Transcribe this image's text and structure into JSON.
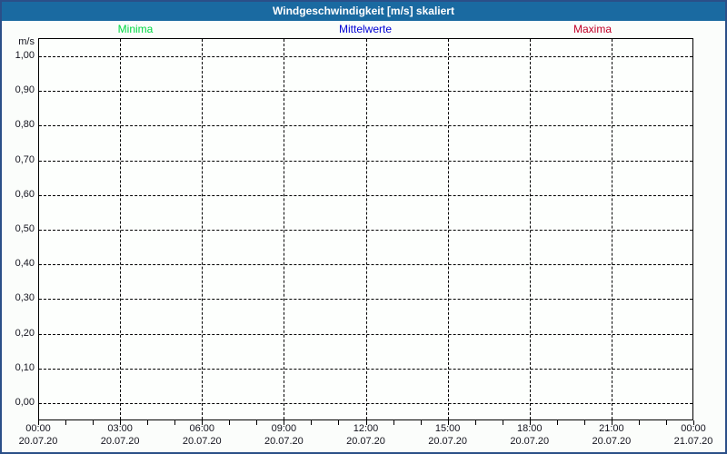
{
  "window": {
    "title": "Windgeschwindigkeit [m/s] skaliert"
  },
  "legend": {
    "items": [
      {
        "label": "Minima",
        "color": "#00d843"
      },
      {
        "label": "Mittelwerte",
        "color": "#0000d4"
      },
      {
        "label": "Maxima",
        "color": "#c00028"
      }
    ]
  },
  "y_axis": {
    "unit": "m/s",
    "tick_labels": [
      "1,00",
      "0,90",
      "0,80",
      "0,70",
      "0,60",
      "0,50",
      "0,40",
      "0,30",
      "0,20",
      "0,10",
      "0,00"
    ]
  },
  "x_axis": {
    "major_ticks": [
      {
        "time": "00:00",
        "date": "20.07.20"
      },
      {
        "time": "03:00",
        "date": "20.07.20"
      },
      {
        "time": "06:00",
        "date": "20.07.20"
      },
      {
        "time": "09:00",
        "date": "20.07.20"
      },
      {
        "time": "12:00",
        "date": "20.07.20"
      },
      {
        "time": "15:00",
        "date": "20.07.20"
      },
      {
        "time": "18:00",
        "date": "20.07.20"
      },
      {
        "time": "21:00",
        "date": "20.07.20"
      },
      {
        "time": "00:00",
        "date": "21.07.20"
      }
    ]
  },
  "chart_data": {
    "type": "line",
    "title": "Windgeschwindigkeit [m/s] skaliert",
    "ylabel": "m/s",
    "ylim": [
      0.0,
      1.0
    ],
    "y_tick_interval": 0.1,
    "x_range": [
      "20.07.20 00:00",
      "21.07.20 00:00"
    ],
    "x_tick_interval_hours": 3,
    "x_minor_tick_interval_hours": 1,
    "grid": "dashed",
    "legend_position": "top",
    "series": [
      {
        "name": "Minima",
        "color": "#00d843",
        "values": []
      },
      {
        "name": "Mittelwerte",
        "color": "#0000d4",
        "values": []
      },
      {
        "name": "Maxima",
        "color": "#c00028",
        "values": []
      }
    ]
  }
}
